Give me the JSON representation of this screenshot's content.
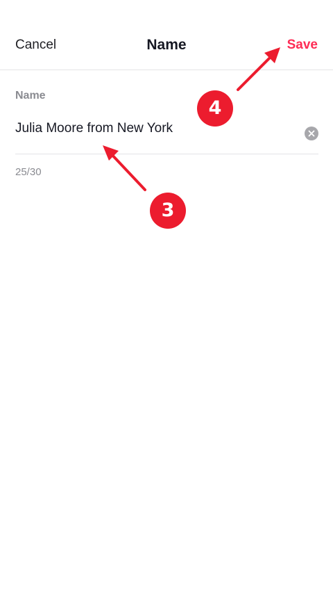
{
  "header": {
    "cancel_label": "Cancel",
    "title": "Name",
    "save_label": "Save"
  },
  "form": {
    "field_label": "Name",
    "name_value": "Julia Moore from New York",
    "counter": "25/30"
  },
  "annotations": {
    "step_save": "4",
    "step_input": "3"
  },
  "colors": {
    "accent": "#fe2c55",
    "annotation": "#ec1c2e",
    "muted_text": "#8a8b91",
    "primary_text": "#161823",
    "divider": "#e3e3e6"
  },
  "icons": {
    "clear": "clear-icon"
  }
}
